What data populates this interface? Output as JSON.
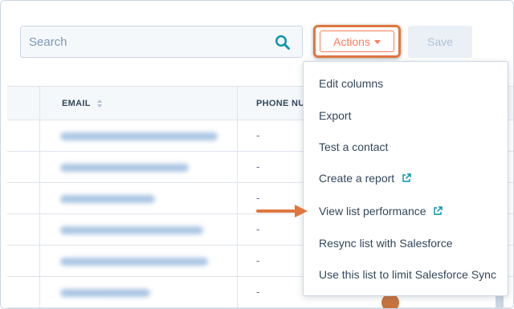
{
  "toolbar": {
    "search_placeholder": "Search",
    "actions_label": "Actions",
    "save_label": "Save"
  },
  "table": {
    "columns": [
      "EMAIL",
      "PHONE NU"
    ],
    "rows": [
      {
        "phone": "-"
      },
      {
        "phone": "-"
      },
      {
        "phone": "-"
      },
      {
        "phone": "-"
      },
      {
        "phone": "-"
      },
      {
        "phone": "-"
      }
    ]
  },
  "actions_menu": {
    "items": [
      {
        "label": "Edit columns",
        "external": false
      },
      {
        "label": "Export",
        "external": false
      },
      {
        "label": "Test a contact",
        "external": false
      },
      {
        "label": "Create a report",
        "external": true
      },
      {
        "label": "View list performance",
        "external": true
      },
      {
        "label": "Resync list with Salesforce",
        "external": false
      },
      {
        "label": "Use this list to limit Salesforce Sync",
        "external": false
      }
    ]
  },
  "icons": {
    "search": "search-icon",
    "caret": "caret-down-icon",
    "sort": "sort-icon",
    "external": "external-link-icon",
    "arrow": "annotation-arrow-icon"
  },
  "colors": {
    "accent": "#ff7a59",
    "highlight": "#e0773f",
    "search_icon": "#0091ae",
    "link_icon": "#0091ae",
    "text": "#33475b"
  }
}
